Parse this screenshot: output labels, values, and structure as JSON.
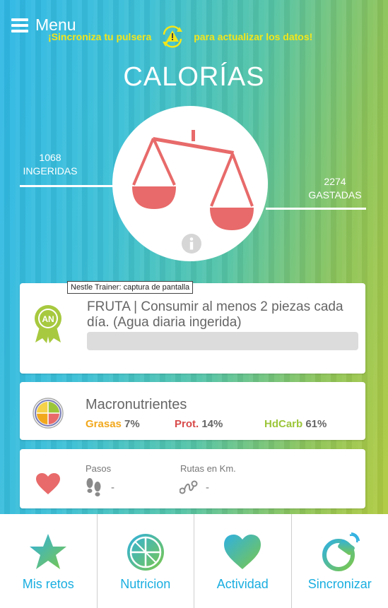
{
  "header": {
    "menu_label": "Menu",
    "sync_prefix": "¡Sincroniza tu pulsera",
    "sync_suffix": "para actualizar los datos!"
  },
  "calories": {
    "title": "CALORÍAS",
    "ingested_value": "1068",
    "ingested_label": "INGERIDAS",
    "spent_value": "2274",
    "spent_label": "GASTADAS"
  },
  "tooltip": "Nestle Trainer: captura de pantalla",
  "goal": {
    "badge_text": "AN",
    "text": "FRUTA | Consumir al menos 2 piezas cada día. (Agua diaria ingerida)",
    "progress": 0
  },
  "macros": {
    "title": "Macronutrientes",
    "items": [
      {
        "label": "Grasas",
        "value": "7%",
        "color": "#f2a81d"
      },
      {
        "label": "Prot.",
        "value": "14%",
        "color": "#d84a4a"
      },
      {
        "label": "HdCarb",
        "value": "61%",
        "color": "#9cc63a"
      }
    ]
  },
  "activity": {
    "steps_label": "Pasos",
    "steps_value": "-",
    "routes_label": "Rutas en Km.",
    "routes_value": "-"
  },
  "nav": [
    {
      "label": "Mis retos",
      "icon": "star-icon"
    },
    {
      "label": "Nutricion",
      "icon": "nutrition-icon"
    },
    {
      "label": "Actividad",
      "icon": "heart-icon"
    },
    {
      "label": "Sincronizar",
      "icon": "sync-band-icon"
    }
  ],
  "colors": {
    "accent": "#1aaee0",
    "scale": "#e86a6a",
    "sync_text": "#f3e61a"
  }
}
